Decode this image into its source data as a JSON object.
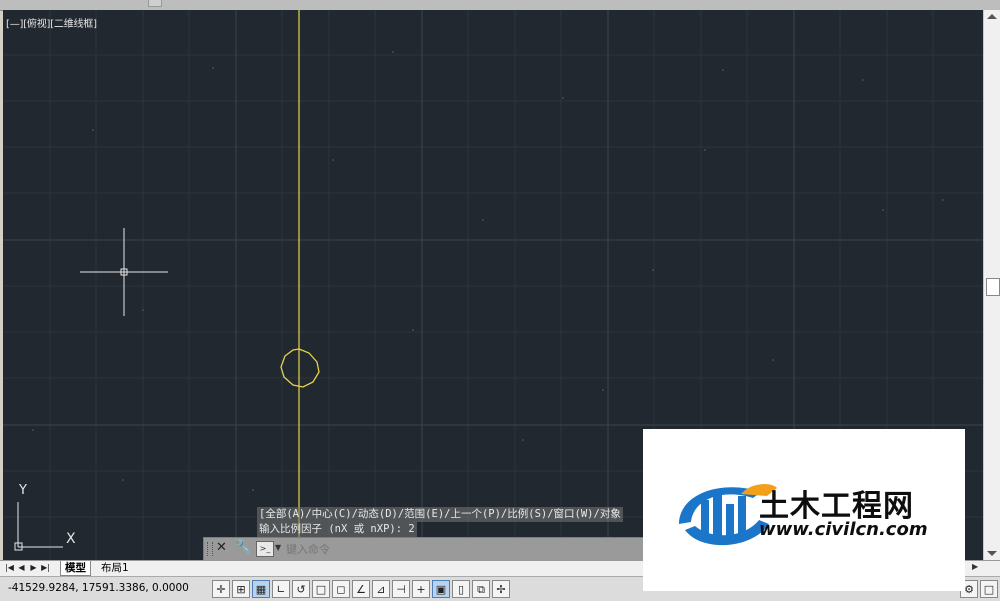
{
  "window": {
    "viewport_label": "[—][俯视][二维线框]"
  },
  "drawing": {
    "background": "#212830",
    "object_color": "#e5d44a",
    "crosshair_color": "#e6e6e6"
  },
  "command": {
    "history_line1": "[全部(A)/中心(C)/动态(D)/范围(E)/上一个(P)/比例(S)/窗口(W)/对象",
    "history_line2": "输入比例因子 (nX 或 nXP): 2",
    "input_placeholder": "键入命令"
  },
  "tabs": {
    "model": "模型",
    "layout1": "布局1"
  },
  "status": {
    "coordinates": "-41529.9284, 17591.3386, 0.0000"
  },
  "axis": {
    "x": "X",
    "y": "Y"
  },
  "watermark": {
    "title": "土木工程网",
    "url": "www.civilcn.com"
  }
}
